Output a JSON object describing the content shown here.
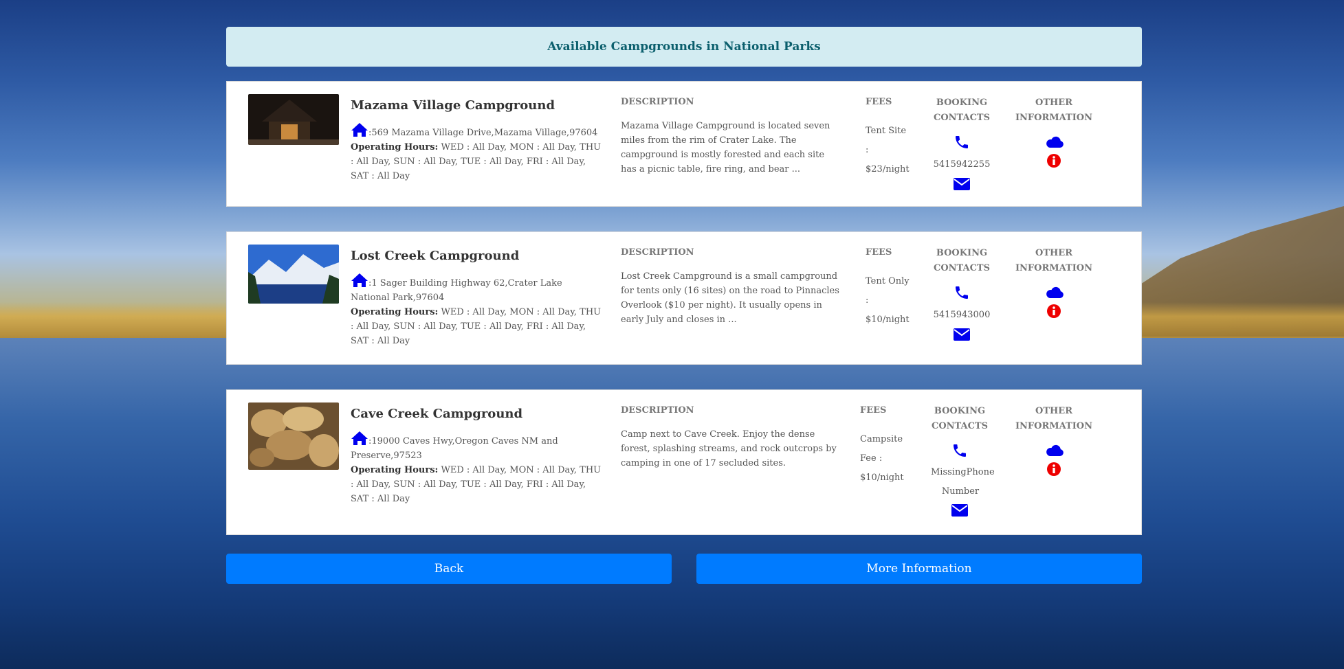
{
  "header": {
    "title": "Available Campgrounds in National Parks"
  },
  "labels": {
    "description": "DESCRIPTION",
    "fees": "FEES",
    "booking_line1": "BOOKING",
    "booking_line2": "CONTACTS",
    "other_line1": "OTHER",
    "other_line2": "INFORMATION",
    "operating_hours": "Operating Hours:"
  },
  "campgrounds": [
    {
      "name": "Mazama Village Campground",
      "address": ":569 Mazama Village Drive,Mazama Village,97604",
      "hours": "WED : All Day, MON : All Day, THU : All Day, SUN : All Day, TUE : All Day, FRI : All Day, SAT : All Day",
      "description": "Mazama Village Campground is located seven miles from the rim of Crater Lake. The campground is mostly forested and each site has a picnic table, fire ring, and bear ...",
      "fees": "Tent Site : $23/night",
      "phone": "5415942255"
    },
    {
      "name": "Lost Creek Campground",
      "address": ":1 Sager Building Highway 62,Crater Lake National Park,97604",
      "hours": "WED : All Day, MON : All Day, THU : All Day, SUN : All Day, TUE : All Day, FRI : All Day, SAT : All Day",
      "description": "Lost Creek Campground is a small campground for tents only (16 sites) on the road to Pinnacles Overlook ($10 per night). It usually opens in early July and closes in ...",
      "fees": "Tent Only : $10/night",
      "phone": "5415943000"
    },
    {
      "name": "Cave Creek Campground",
      "address": ":19000 Caves Hwy,Oregon Caves NM and Preserve,97523",
      "hours": "WED : All Day, MON : All Day, THU : All Day, SUN : All Day, TUE : All Day, FRI : All Day, SAT : All Day",
      "description": "Camp next to Cave Creek. Enjoy the dense forest, splashing streams, and rock outcrops by camping in one of 17 secluded sites.",
      "fees": "Campsite Fee : $10/night",
      "phone": "MissingPhone Number"
    }
  ],
  "buttons": {
    "back": "Back",
    "more_info": "More Information"
  },
  "colors": {
    "accent": "#007bff",
    "icon_blue": "#0000ee",
    "info_red": "#ee0000",
    "header_bg": "#d3ecf2",
    "header_text": "#0b5f6d"
  }
}
